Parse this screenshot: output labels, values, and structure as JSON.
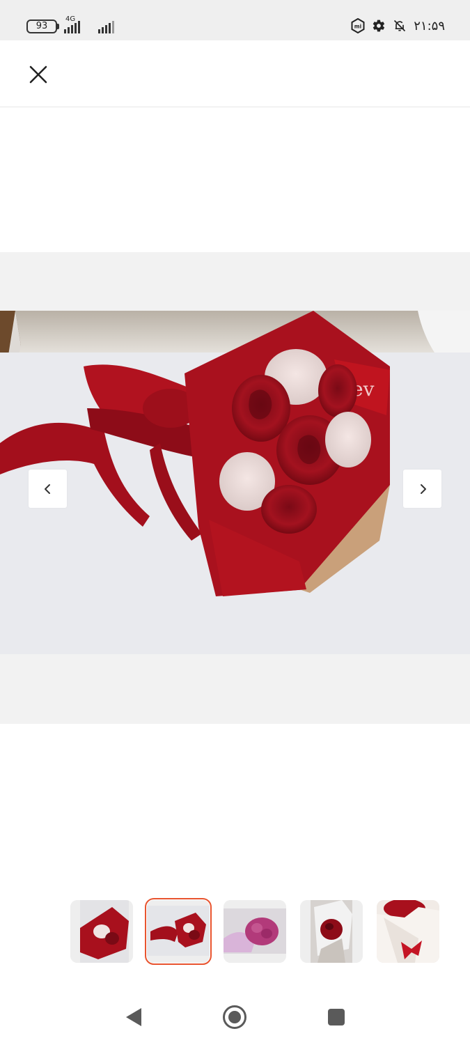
{
  "status_bar": {
    "battery_level": "93",
    "network_type": "4G",
    "time": "۲۱:۵۹",
    "icons": [
      "mi-icon",
      "gear-icon",
      "bell-off-icon",
      "signal-icon",
      "signal-icon"
    ]
  },
  "header": {
    "close_icon": "close-icon"
  },
  "gallery": {
    "photo_brand_text": "ev",
    "prev_icon": "chevron-left-icon",
    "next_icon": "chevron-right-icon",
    "active_index": 1,
    "thumbnail_count": 5,
    "accent_color": "#e8542f"
  },
  "android_nav": {
    "icons": [
      "back-icon",
      "home-icon",
      "recents-icon"
    ]
  }
}
